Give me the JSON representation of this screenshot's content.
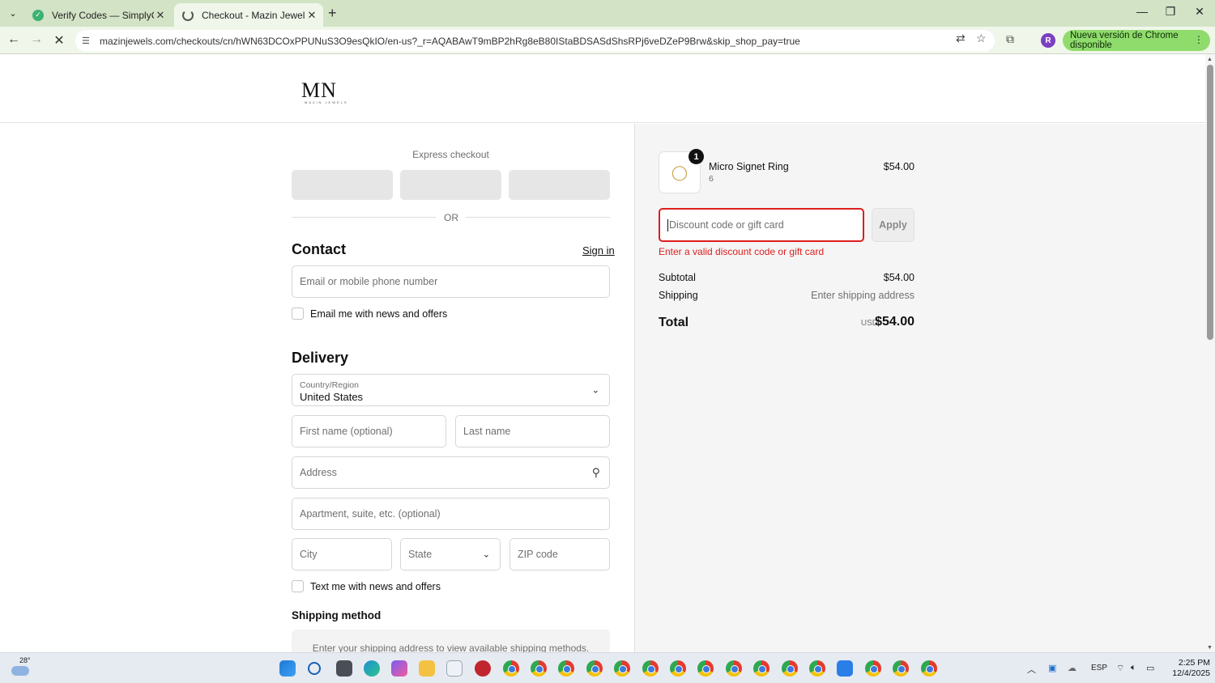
{
  "browser": {
    "tabs": [
      {
        "title": "Verify Codes — SimplyCodes",
        "active": false
      },
      {
        "title": "Checkout - Mazin Jewels",
        "active": true
      }
    ],
    "url": "mazinjewels.com/checkouts/cn/hWN63DCOxPPUNuS3O9esQkIO/en-us?_r=AQABAwT9mBP2hRg8eB80IStaBDSASdShsRPj6veDZeP9Brw&skip_shop_pay=true",
    "profile_initial": "R",
    "update_label": "Nueva versión de Chrome disponible"
  },
  "store": {
    "logo_text": "MN",
    "logo_sub": "MAZIN JEWELS"
  },
  "checkout": {
    "express_title": "Express checkout",
    "or_label": "OR",
    "contact": {
      "heading": "Contact",
      "signin_label": "Sign in",
      "email_placeholder": "Email or mobile phone number",
      "news_label": "Email me with news and offers"
    },
    "delivery": {
      "heading": "Delivery",
      "country_label": "Country/Region",
      "country_value": "United States",
      "first_name_placeholder": "First name (optional)",
      "last_name_placeholder": "Last name",
      "address_placeholder": "Address",
      "apartment_placeholder": "Apartment, suite, etc. (optional)",
      "city_placeholder": "City",
      "state_placeholder": "State",
      "zip_placeholder": "ZIP code",
      "text_news_label": "Text me with news and offers"
    },
    "shipping_method": {
      "heading": "Shipping method",
      "message": "Enter your shipping address to view available shipping methods."
    }
  },
  "summary": {
    "product": {
      "quantity": "1",
      "name": "Micro Signet Ring",
      "variant": "6",
      "price": "$54.00"
    },
    "discount_placeholder": "Discount code or gift card",
    "apply_label": "Apply",
    "error": "Enter a valid discount code or gift card",
    "subtotal_label": "Subtotal",
    "subtotal_value": "$54.00",
    "shipping_label": "Shipping",
    "shipping_value": "Enter shipping address",
    "total_label": "Total",
    "currency": "USD",
    "total_value": "$54.00"
  },
  "taskbar": {
    "temperature": "28°",
    "language": "ESP",
    "time": "2:25 PM",
    "date": "12/4/2025"
  }
}
